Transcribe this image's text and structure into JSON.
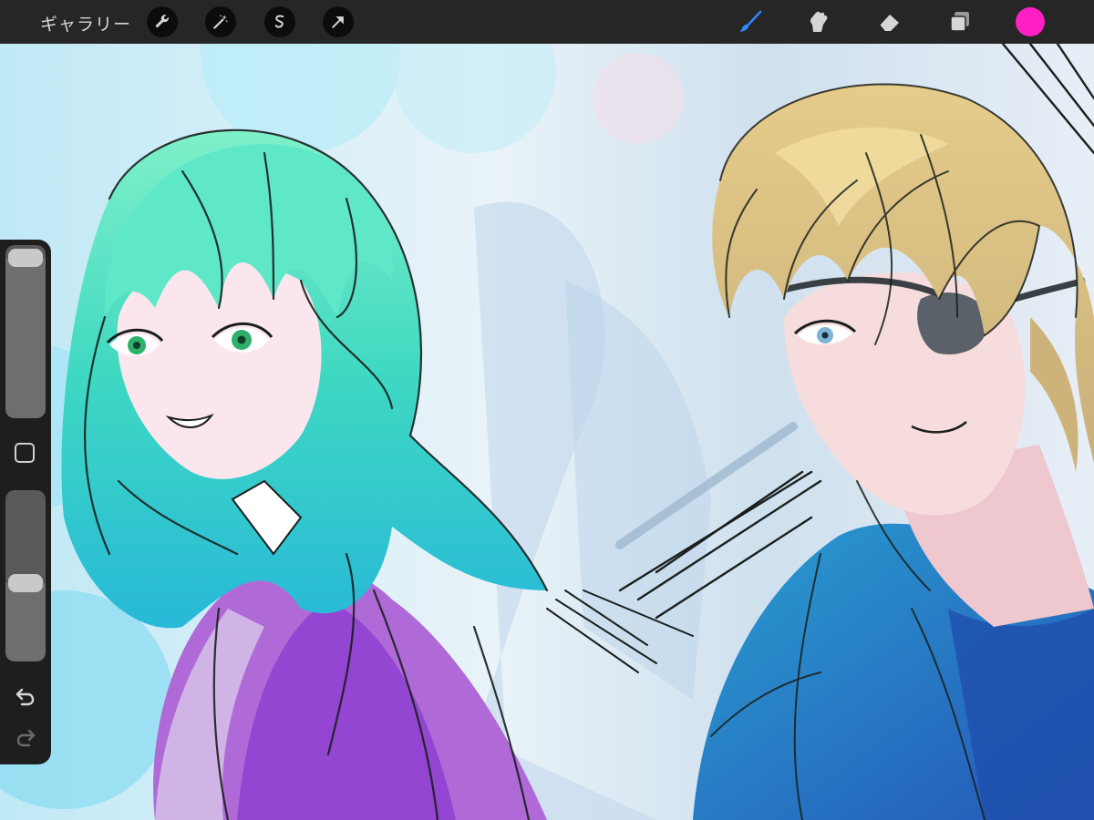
{
  "toolbar": {
    "gallery_label": "ギャラリー",
    "left_tools": [
      "wrench-icon",
      "magic-wand-icon",
      "selection-icon",
      "transform-arrow-icon"
    ],
    "right_tools": [
      "brush-icon",
      "smudge-icon",
      "eraser-icon",
      "layers-icon"
    ],
    "active_tool": "brush-icon",
    "active_color": "#ff1fc2",
    "active_tool_color": "#2f86ff"
  },
  "sidebar": {
    "brush_size_level": 0.0,
    "opacity_level": 0.55,
    "modify_button": "square-modify-icon",
    "undo_icon": "undo-icon",
    "redo_icon": "redo-icon",
    "redo_enabled": false
  },
  "canvas": {
    "description_palette": {
      "background": "#dcecf5",
      "left_hair": "#3fd6b6",
      "left_jacket": "#a04ad0",
      "right_hair": "#d9c084",
      "right_jacket": "#2f74c4",
      "lineart": "#1a1f1d"
    }
  }
}
